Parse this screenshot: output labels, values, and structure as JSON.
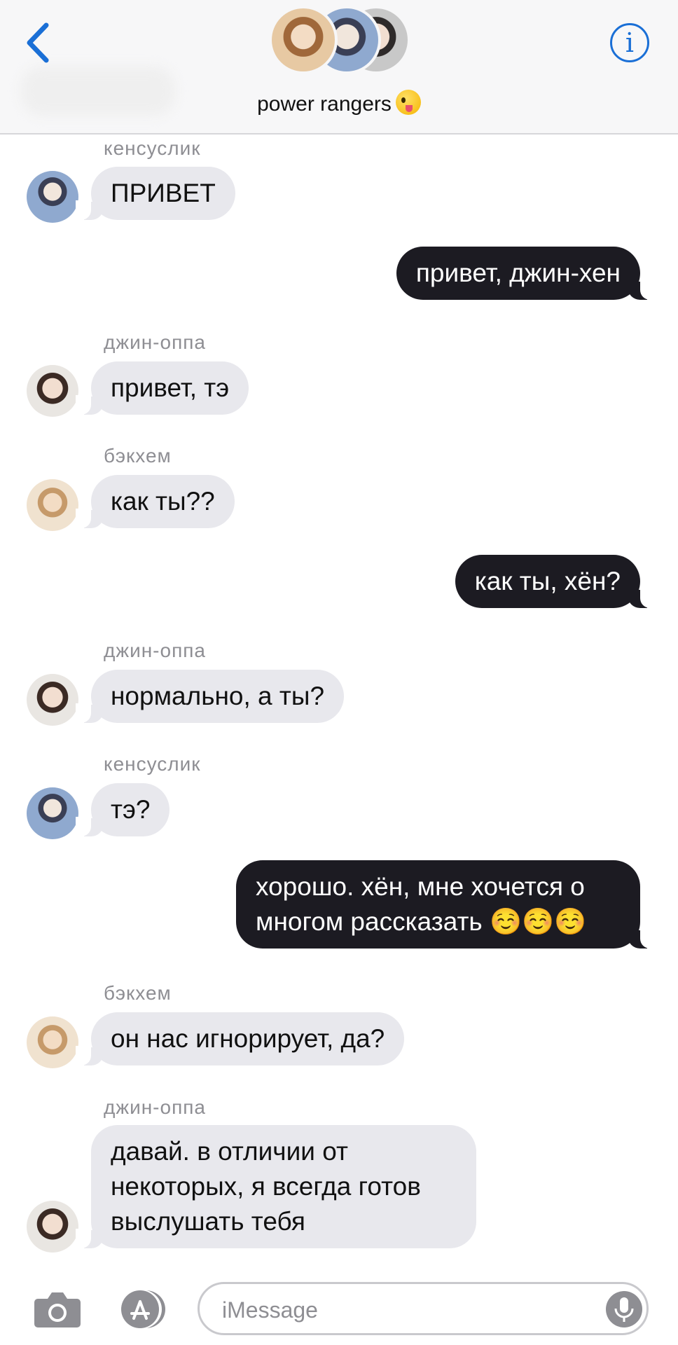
{
  "header": {
    "group_name": "power rangers",
    "group_emoji": "zany-face-emoji",
    "accent_color": "#1a6fd6"
  },
  "messages": [
    {
      "sender": "кенсуслик",
      "text": "ПРИВЕТ",
      "direction": "incoming"
    },
    {
      "text": "привет, джин-хен",
      "direction": "outgoing"
    },
    {
      "sender": "джин-оппа",
      "text": "привет, тэ",
      "direction": "incoming"
    },
    {
      "sender": "бэкхем",
      "text": "как ты??",
      "direction": "incoming"
    },
    {
      "text": "как ты, хён?",
      "direction": "outgoing"
    },
    {
      "sender": "джин-оппа",
      "text": "нормально, а ты?",
      "direction": "incoming"
    },
    {
      "sender": "кенсуслик",
      "text": "тэ?",
      "direction": "incoming"
    },
    {
      "text": "хорошо. хён, мне хочется о многом рассказать ☺️☺️☺️",
      "direction": "outgoing"
    },
    {
      "sender": "бэкхем",
      "text": "он нас игнорирует, да?",
      "direction": "incoming"
    },
    {
      "sender": "джин-оппа",
      "text": "давай. в отличии от некоторых, я всегда готов выслушать тебя",
      "direction": "incoming"
    }
  ],
  "composer": {
    "placeholder": "iMessage"
  },
  "colors": {
    "incoming_bubble": "#e8e8ed",
    "outgoing_bubble": "#1c1b22"
  }
}
